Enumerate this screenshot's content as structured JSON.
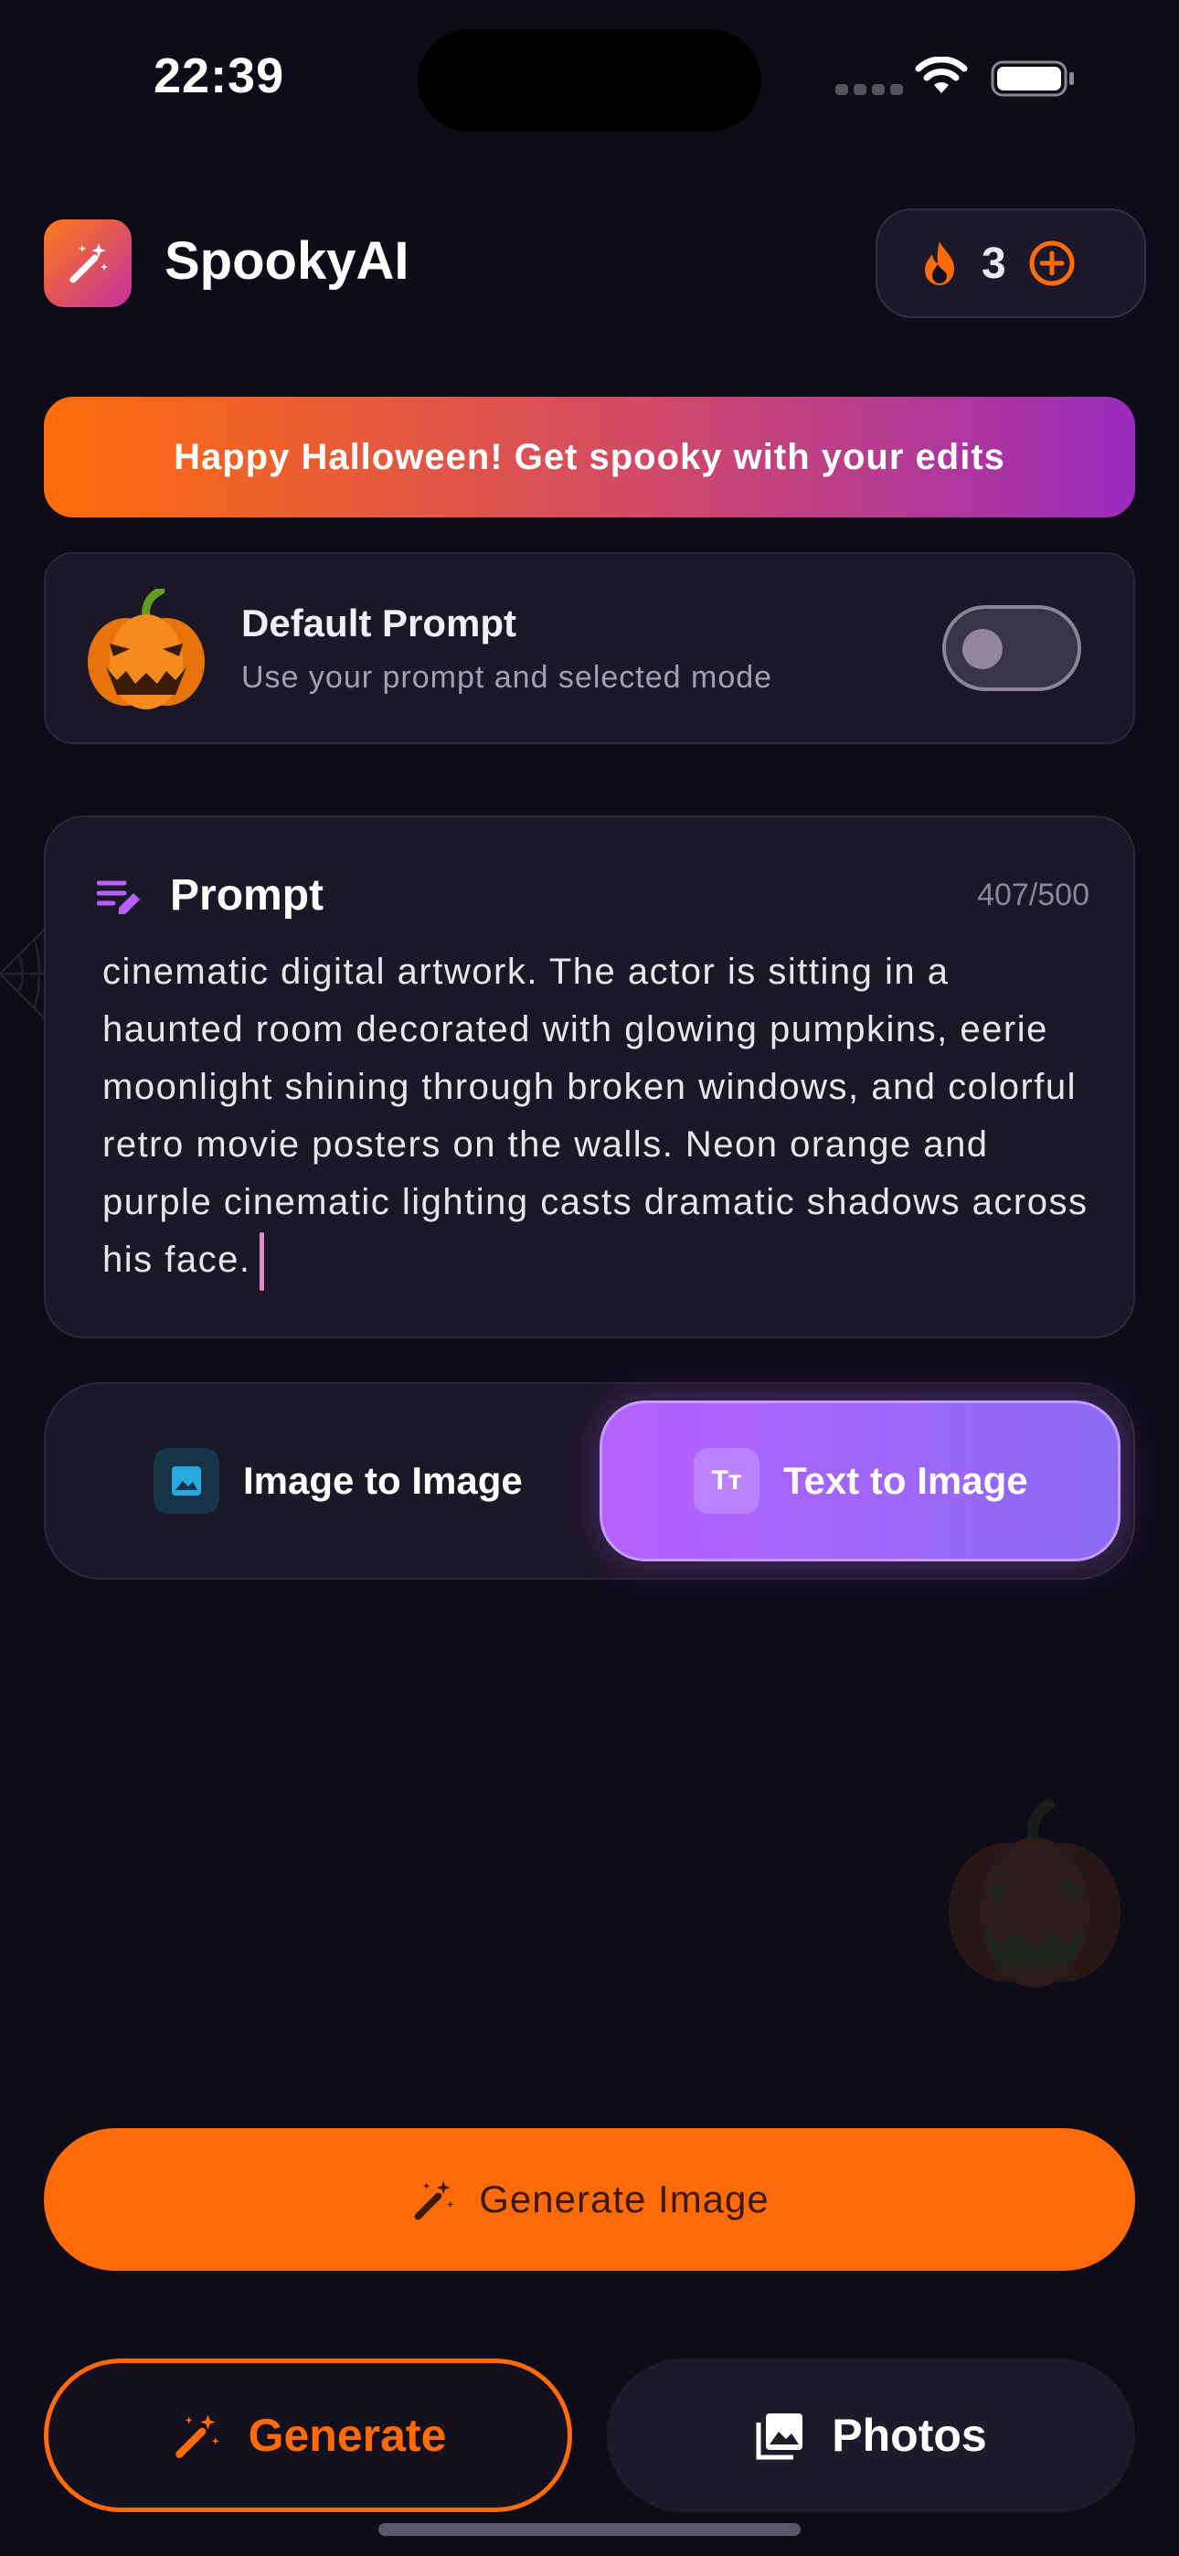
{
  "status_bar": {
    "time": "22:39"
  },
  "header": {
    "app_name": "SpookyAI",
    "credits": "3"
  },
  "banner": {
    "text": "Happy Halloween! Get spooky with your edits"
  },
  "default_prompt": {
    "title": "Default Prompt",
    "subtitle": "Use your prompt and selected mode",
    "toggle_on": false
  },
  "prompt": {
    "label": "Prompt",
    "counter": "407/500",
    "text": "cinematic digital artwork. The actor is sitting in a haunted room decorated with glowing pumpkins, eerie moonlight shining through broken windows, and colorful retro movie posters on the walls. Neon orange and purple cinematic lighting casts dramatic shadows across his face."
  },
  "modes": {
    "image_to_image": "Image to Image",
    "text_to_image": "Text to Image",
    "text_badge": "Tт",
    "selected": "text_to_image"
  },
  "actions": {
    "generate_image": "Generate Image"
  },
  "tabs": {
    "generate": "Generate",
    "photos": "Photos",
    "active": "generate"
  },
  "colors": {
    "accent_orange": "#ff6b08",
    "accent_purple": "#b661ff",
    "background": "#0f0c1a",
    "card": "#1b1727"
  },
  "icons": {
    "logo": "magic-wand-icon",
    "credits": "flame-icon",
    "add": "plus-circle-icon",
    "prompt": "edit-lines-icon",
    "image_mode": "image-icon",
    "generate": "magic-wand-icon",
    "photos": "photo-library-icon"
  }
}
